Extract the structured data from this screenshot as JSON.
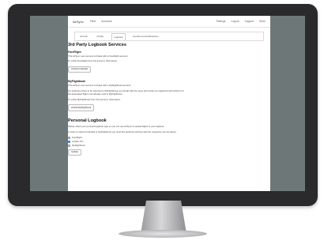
{
  "topnav": {
    "brand": "AirSync",
    "items": [
      "Fleet",
      "Accounts"
    ],
    "right_items": [
      "Settings",
      "Logout",
      "Support",
      "Store"
    ]
  },
  "tabs": [
    {
      "label": "Aircraft",
      "active": false
    },
    {
      "label": "Profile",
      "active": false
    },
    {
      "label": "Logbook",
      "active": true
    },
    {
      "label": "Emails and Notifications",
      "active": false
    }
  ],
  "third_party": {
    "title": "3rd Party Logbook Services",
    "foreflight": {
      "heading": "ForeFlight",
      "desc": "This AirSync user account is linked with a ForeFlight account.",
      "hint": "To unlink ForeFlight from this account, click below:",
      "button": "Unlink ForeFlight"
    },
    "myflightbook": {
      "heading": "MyFlightbook",
      "desc": "This AirSync user account is linked with a MyFlightbook account.",
      "desc2": "For logbook entries to be imported to MyFlightbook, an aircraft with the same tail number as registered with AirSync for the associated flight must already exist in MyFlightbook.",
      "hint": "To unlink MyFlightbook from this account, click below:",
      "button": "Unlink MyFlightbook"
    }
  },
  "personal": {
    "title": "Personal Logbook",
    "desc": "Please select your personal logbook type so you can use AirSync to upload flights to your logbook.",
    "note": "In order to select ForeFlight or MyFlightbook you must first authorize AirSync with the respective service above.",
    "options": [
      {
        "label": "ForeFlight",
        "checked": false
      },
      {
        "label": "LogTen Pro",
        "checked": true
      },
      {
        "label": "MyFlightbook",
        "checked": false
      }
    ],
    "button": "Update"
  },
  "colors": {
    "bezel": "#2a2a2c",
    "screen_background": "#6e7778",
    "radio_selected": "#1f6feb"
  }
}
